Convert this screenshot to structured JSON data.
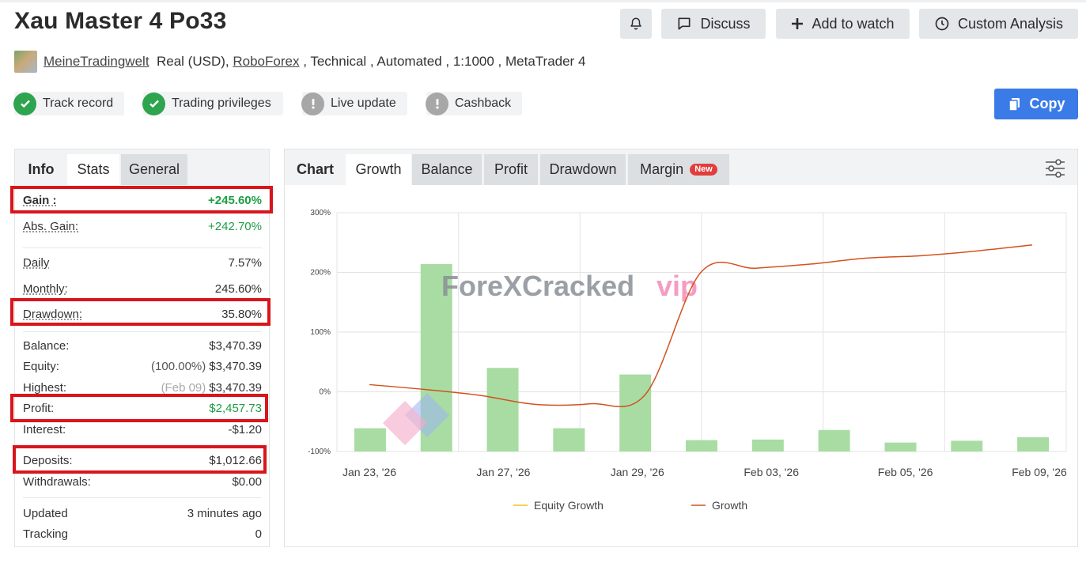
{
  "header": {
    "title": "Xau Master 4 Po33",
    "buttons": {
      "discuss": "Discuss",
      "add_to_watch": "Add to watch",
      "custom_analysis": "Custom Analysis"
    }
  },
  "meta": {
    "username": "MeineTradingwelt",
    "account_type": "Real (USD),",
    "broker": "RoboForex",
    "details": " , Technical , Automated , 1:1000 , MetaTrader 4"
  },
  "badges": [
    {
      "label": "Track record",
      "status": "verified"
    },
    {
      "label": "Trading privileges",
      "status": "verified"
    },
    {
      "label": "Live update",
      "status": "warning"
    },
    {
      "label": "Cashback",
      "status": "warning"
    }
  ],
  "copy_button": "Copy",
  "left_tabs": {
    "info": "Info",
    "stats": "Stats",
    "general": "General"
  },
  "stats": {
    "gain": {
      "label": "Gain :",
      "value": "+245.60%"
    },
    "abs_gain": {
      "label": "Abs. Gain:",
      "value": "+242.70%"
    },
    "daily": {
      "label": "Daily",
      "value": "7.57%"
    },
    "monthly": {
      "label": "Monthly:",
      "value": "245.60%"
    },
    "drawdown": {
      "label": "Drawdown:",
      "value": "35.80%"
    },
    "balance": {
      "label": "Balance:",
      "value": "$3,470.39"
    },
    "equity": {
      "label": "Equity:",
      "sub": "(100.00%)",
      "value": "$3,470.39"
    },
    "highest": {
      "label": "Highest:",
      "sub": "(Feb 09)",
      "value": "$3,470.39"
    },
    "profit": {
      "label": "Profit:",
      "value": "$2,457.73"
    },
    "interest": {
      "label": "Interest:",
      "value": "-$1.20"
    },
    "deposits": {
      "label": "Deposits:",
      "value": "$1,012.66"
    },
    "withdrawals": {
      "label": "Withdrawals:",
      "value": "$0.00"
    },
    "updated": {
      "label": "Updated",
      "value": "3 minutes ago"
    },
    "tracking": {
      "label": "Tracking",
      "value": "0"
    }
  },
  "chart_tabs": {
    "label": "Chart",
    "growth": "Growth",
    "balance": "Balance",
    "profit": "Profit",
    "drawdown": "Drawdown",
    "margin": "Margin",
    "new_tag": "New"
  },
  "watermark": {
    "main": "ForeXCracked",
    "suffix": "vip"
  },
  "colors": {
    "accent_blue": "#3a7be8",
    "verified_green": "#2ea44f",
    "gain_green": "#1f9e45",
    "highlight_red": "#d9151c",
    "bar_green": "#a8dca3",
    "growth_line": "#d2521f",
    "equity_line": "#f0c419"
  },
  "chart_data": {
    "type": "bar",
    "y_tick_labels": [
      "300%",
      "200%",
      "100%",
      "0%",
      "-100%"
    ],
    "ylim": [
      -100,
      300
    ],
    "x_tick_labels": [
      "Jan 23, '26",
      "Jan 27, '26",
      "Jan 29, '26",
      "Feb 03, '26",
      "Feb 05, '26",
      "Feb 09, '26"
    ],
    "series": [
      {
        "name": "Equity Growth",
        "type": "line",
        "values": []
      },
      {
        "name": "Growth",
        "type": "line",
        "values": [
          12,
          4,
          -6,
          -21,
          -20,
          -4,
          200,
          207,
          214,
          224,
          228,
          236,
          246
        ]
      },
      {
        "type": "bar",
        "values": [
          -61,
          214,
          40,
          -61,
          29,
          -81,
          -80,
          -64,
          -85,
          -82,
          -76
        ]
      }
    ],
    "legend_position": "bottom",
    "grid": true
  }
}
